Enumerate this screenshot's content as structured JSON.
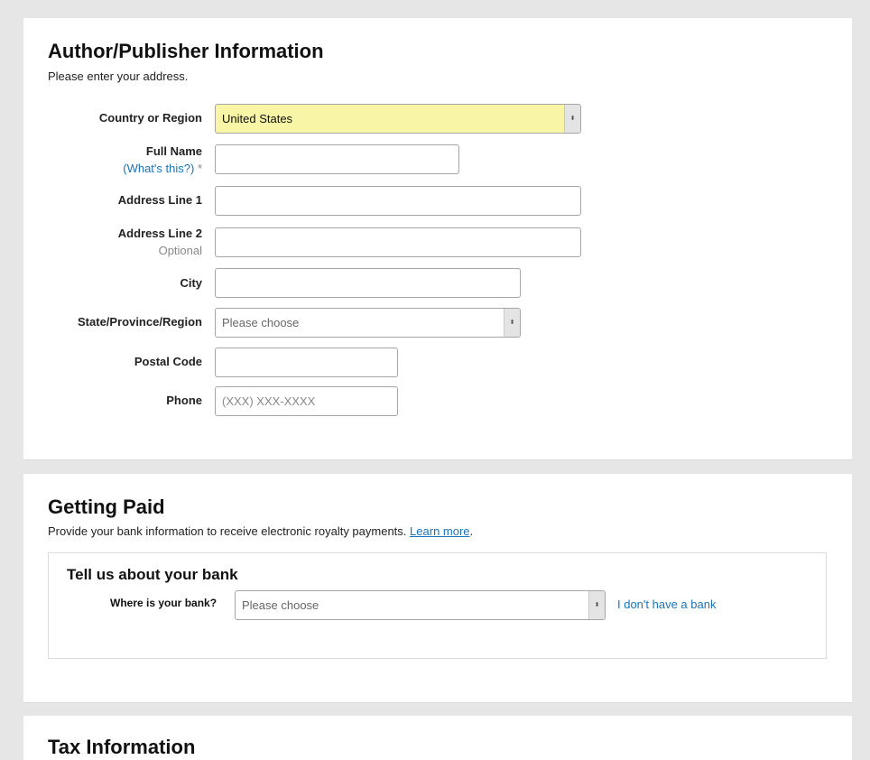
{
  "author": {
    "title": "Author/Publisher Information",
    "subtitle": "Please enter your address.",
    "country": {
      "label": "Country or Region",
      "value": "United States"
    },
    "full_name": {
      "label": "Full Name",
      "help_link": "(What's this?)",
      "required_mark": "*",
      "value": ""
    },
    "address1": {
      "label": "Address Line 1",
      "value": ""
    },
    "address2": {
      "label": "Address Line 2",
      "sublabel": "Optional",
      "value": ""
    },
    "city": {
      "label": "City",
      "value": ""
    },
    "state": {
      "label": "State/Province/Region",
      "value": "Please choose"
    },
    "postal": {
      "label": "Postal Code",
      "value": ""
    },
    "phone": {
      "label": "Phone",
      "placeholder": "(XXX) XXX-XXXX",
      "value": ""
    }
  },
  "paid": {
    "title": "Getting Paid",
    "subtitle": "Provide your bank information to receive electronic royalty payments.",
    "learn_more": "Learn more",
    "subtitle_end": ".",
    "bank": {
      "title": "Tell us about your bank",
      "label": "Where is your bank?",
      "value": "Please choose",
      "no_bank_link": "I don't have a bank"
    }
  },
  "tax": {
    "title": "Tax Information"
  },
  "icons": {
    "select_arrow": "⬍"
  },
  "colors": {
    "link": "#1a73b8",
    "highlight": "#f8f5a6",
    "page_bg": "#e6e6e6"
  }
}
